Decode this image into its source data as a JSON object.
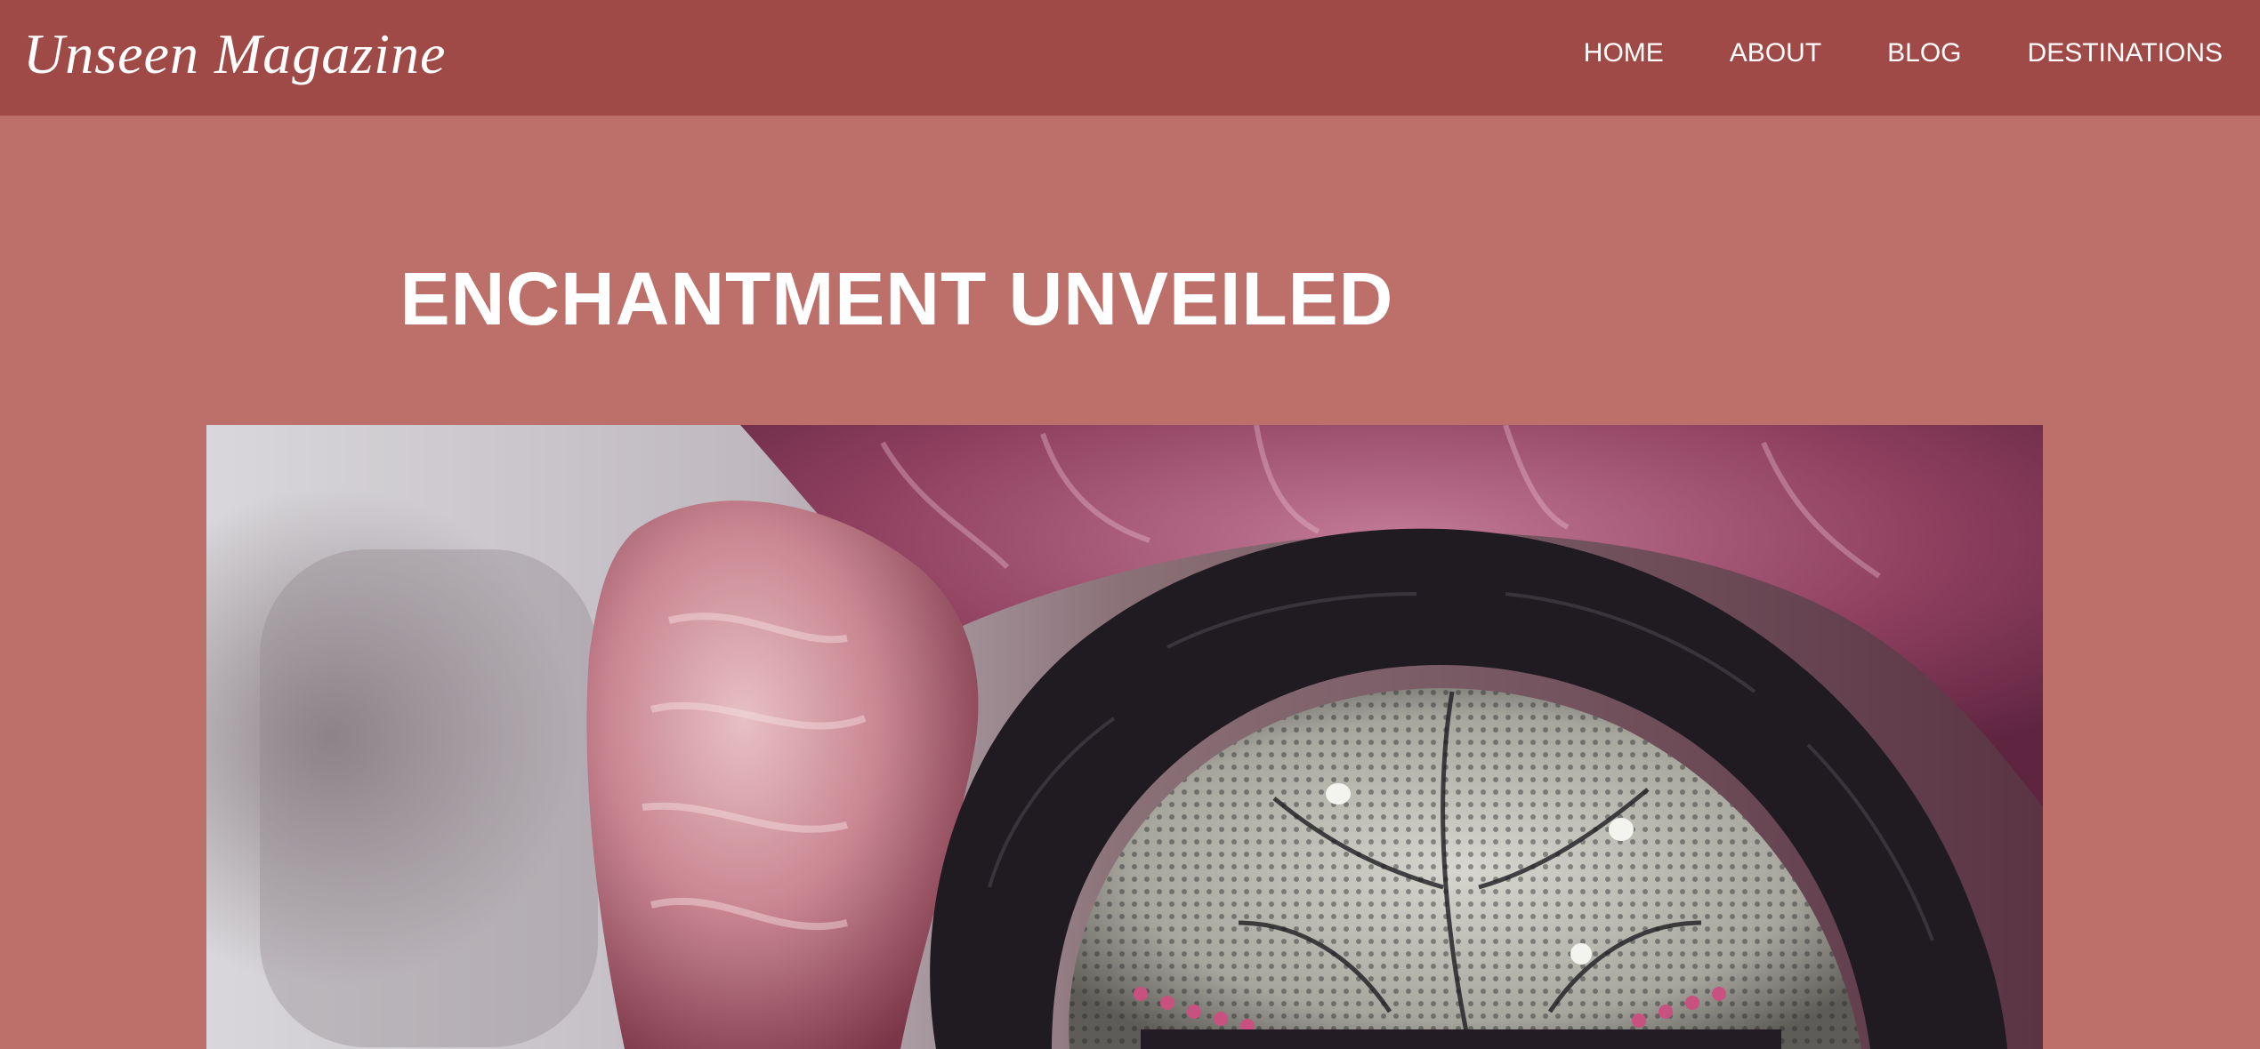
{
  "header": {
    "brand": "Unseen Magazine",
    "nav": [
      {
        "label": "HOME"
      },
      {
        "label": "ABOUT"
      },
      {
        "label": "BLOG"
      },
      {
        "label": "DESTINATIONS"
      }
    ]
  },
  "main": {
    "headline": "ENCHANTMENT UNVEILED"
  },
  "colors": {
    "header_bg": "#a04a47",
    "page_bg": "#bd6f6a",
    "text": "#ffffff"
  }
}
